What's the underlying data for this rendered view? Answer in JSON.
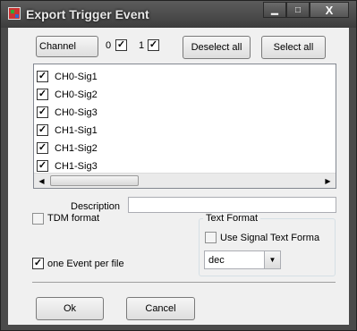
{
  "window": {
    "title": "Export Trigger Event",
    "minimize_glyph": "▁",
    "maximize_glyph": "□",
    "close_glyph": "X"
  },
  "top": {
    "group_select": "Channel",
    "check0_label": "0",
    "check1_label": "1",
    "deselect_all": "Deselect all",
    "select_all": "Select all"
  },
  "signals": {
    "items": [
      {
        "label": "CH0-Sig1",
        "checked": true
      },
      {
        "label": "CH0-Sig2",
        "checked": true
      },
      {
        "label": "CH0-Sig3",
        "checked": true
      },
      {
        "label": "CH1-Sig1",
        "checked": true
      },
      {
        "label": "CH1-Sig2",
        "checked": true
      },
      {
        "label": "CH1-Sig3",
        "checked": true
      }
    ],
    "scroll_left": "◀",
    "scroll_right": "▶"
  },
  "description": {
    "label": "Description",
    "value": ""
  },
  "options": {
    "tdm_format": {
      "label": "TDM format",
      "checked": false
    },
    "one_event_per_file": {
      "label": "one Event per file",
      "checked": true
    }
  },
  "text_format": {
    "title": "Text Format",
    "use_signal_text_format": {
      "label": "Use Signal Text Forma",
      "checked": false
    },
    "encoding": "dec",
    "dropdown_glyph": "▼"
  },
  "footer": {
    "ok": "Ok",
    "cancel": "Cancel"
  },
  "check_glyph": "✓"
}
